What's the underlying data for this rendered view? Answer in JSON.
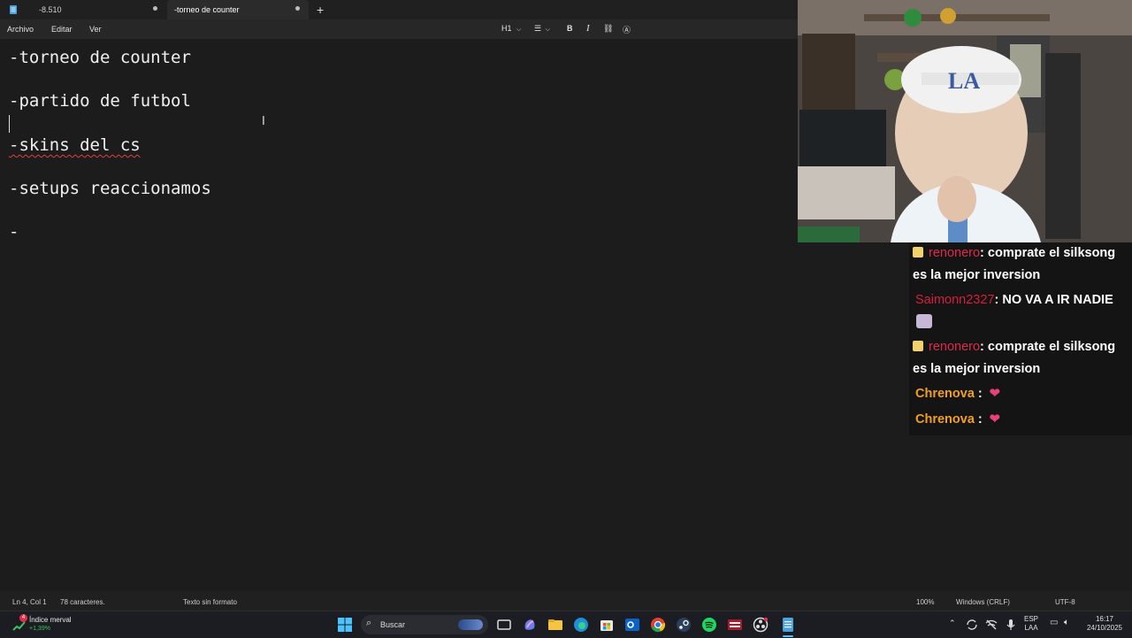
{
  "tabs": [
    {
      "label": "-8.510"
    },
    {
      "label": "-torneo de counter"
    }
  ],
  "menu": {
    "archivo": "Archivo",
    "editar": "Editar",
    "ver": "Ver"
  },
  "toolbar": {
    "heading": "H1"
  },
  "document": {
    "lines": [
      "-torneo de counter",
      "-partido de futbol",
      "-skins del cs",
      "-setups reaccionamos",
      "-"
    ]
  },
  "chat": {
    "messages": [
      {
        "user": "renonero",
        "text": ": comprate el silksong es la mejor inversion",
        "color": "#e02a4a"
      },
      {
        "user": "Saimonn2327",
        "text": ": NO VA A IR NADIE",
        "color": "#d81e3c"
      },
      {
        "user": "renonero",
        "text": ": comprate el silksong es la mejor inversion",
        "color": "#e02a4a"
      },
      {
        "user": "Chrenova",
        "text": ":",
        "color": "#f0a020"
      },
      {
        "user": "Chrenova",
        "text": ":",
        "color": "#f0a020"
      }
    ]
  },
  "status": {
    "position": "Ln 4, Col 1",
    "chars": "78 caracteres.",
    "format": "Texto sin formato",
    "zoom": "100%",
    "eol": "Windows (CRLF)",
    "encoding": "UTF-8"
  },
  "taskbar": {
    "widget_title": "Índice merval",
    "widget_value": "+1,39%",
    "widget_badge": "4",
    "search_placeholder": "Buscar",
    "lang1": "ESP",
    "lang2": "LAA",
    "time": "16:17",
    "date": "24/10/2025"
  },
  "colors": {
    "accent": "#4cc2ff",
    "editor_bg": "#1c1c1c",
    "spell_error": "#e04040"
  }
}
